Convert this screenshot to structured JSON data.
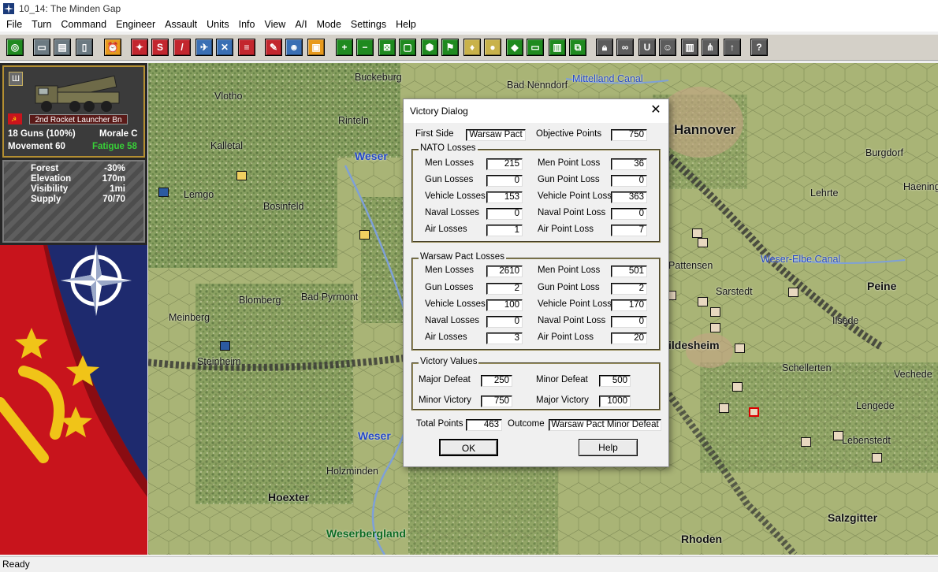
{
  "window": {
    "title": "10_14: The Minden Gap"
  },
  "menu": [
    "File",
    "Turn",
    "Command",
    "Engineer",
    "Assault",
    "Units",
    "Info",
    "View",
    "A/I",
    "Mode",
    "Settings",
    "Help"
  ],
  "unit": {
    "name": "2nd Rocket Launcher Bn",
    "strength": "18 Guns (100%)",
    "morale": "Morale C",
    "movement": "Movement 60",
    "fatigue": "Fatigue 58",
    "badge": "Ш"
  },
  "terrain": [
    {
      "label": "Forest",
      "value": "-30%"
    },
    {
      "label": "Elevation",
      "value": "170m"
    },
    {
      "label": "Visibility",
      "value": "1mi"
    },
    {
      "label": "Supply",
      "value": "70/70"
    }
  ],
  "map_labels": {
    "buckeburg": "Buckeburg",
    "bad_nenndorf": "Bad Nenndorf",
    "mittelland_canal": "Mittelland Canal",
    "vlotho": "Vlotho",
    "rinteln": "Rinteln",
    "hannover": "Hannover",
    "burgdorf": "Burgdorf",
    "kalletal": "Kalletal",
    "weser1": "Weser",
    "lemgo": "Lemgo",
    "lehrte": "Lehrte",
    "haening": "Haening",
    "bosinfeld": "Bosinfeld",
    "pattensen": "Pattensen",
    "weser_elbe_canal": "Weser-Elbe Canal",
    "peine": "Peine",
    "sarstedt": "Sarstedt",
    "blomberg": "Blomberg",
    "bad_pyrmont": "Bad Pyrmont",
    "meinberg": "Meinberg",
    "ilsede": "Ilsede",
    "hildesheim": "ildesheim",
    "steinheim": "Steinheim",
    "schellerten": "Schellerten",
    "vechede": "Vechede",
    "lengede": "Lengede",
    "weser2": "Weser",
    "lebenstedt": "Lebenstedt",
    "holzminden": "Holzminden",
    "hoexter": "Hoexter",
    "salzgitter": "Salzgitter",
    "weserbergland": "Weserbergland",
    "rhoden": "Rhoden"
  },
  "dialog": {
    "title": "Victory Dialog",
    "close": "✕",
    "first_side_label": "First Side",
    "first_side": "Warsaw Pact",
    "objective_points_label": "Objective Points",
    "objective_points": "750",
    "nato": {
      "title": "NATO Losses",
      "rows": [
        {
          "label": "Men Losses",
          "value": "215",
          "plabel": "Men Point Loss",
          "pvalue": "36"
        },
        {
          "label": "Gun Losses",
          "value": "0",
          "plabel": "Gun Point Loss",
          "pvalue": "0"
        },
        {
          "label": "Vehicle Losses",
          "value": "153",
          "plabel": "Vehicle Point Loss",
          "pvalue": "363"
        },
        {
          "label": "Naval Losses",
          "value": "0",
          "plabel": "Naval Point Loss",
          "pvalue": "0"
        },
        {
          "label": "Air Losses",
          "value": "1",
          "plabel": "Air Point Loss",
          "pvalue": "7"
        }
      ]
    },
    "wp": {
      "title": "Warsaw Pact Losses",
      "rows": [
        {
          "label": "Men Losses",
          "value": "2610",
          "plabel": "Men Point Loss",
          "pvalue": "501"
        },
        {
          "label": "Gun Losses",
          "value": "2",
          "plabel": "Gun Point Loss",
          "pvalue": "2"
        },
        {
          "label": "Vehicle Losses",
          "value": "100",
          "plabel": "Vehicle Point Loss",
          "pvalue": "170"
        },
        {
          "label": "Naval Losses",
          "value": "0",
          "plabel": "Naval Point Loss",
          "pvalue": "0"
        },
        {
          "label": "Air Losses",
          "value": "3",
          "plabel": "Air Point Loss",
          "pvalue": "20"
        }
      ]
    },
    "victory": {
      "title": "Victory Values",
      "major_defeat_label": "Major Defeat",
      "major_defeat": "250",
      "minor_defeat_label": "Minor Defeat",
      "minor_defeat": "500",
      "minor_victory_label": "Minor Victory",
      "minor_victory": "750",
      "major_victory_label": "Major Victory",
      "major_victory": "1000"
    },
    "total_points_label": "Total Points",
    "total_points": "463",
    "outcome_label": "Outcome",
    "outcome": "Warsaw Pact Minor Defeat",
    "ok": "OK",
    "help": "Help"
  },
  "status": "Ready",
  "colors": {
    "map_base": "#a9b476",
    "dialog_group_border": "#9a8f5c",
    "fatigue": "#38d038",
    "unit_frame": "#b48f32"
  }
}
